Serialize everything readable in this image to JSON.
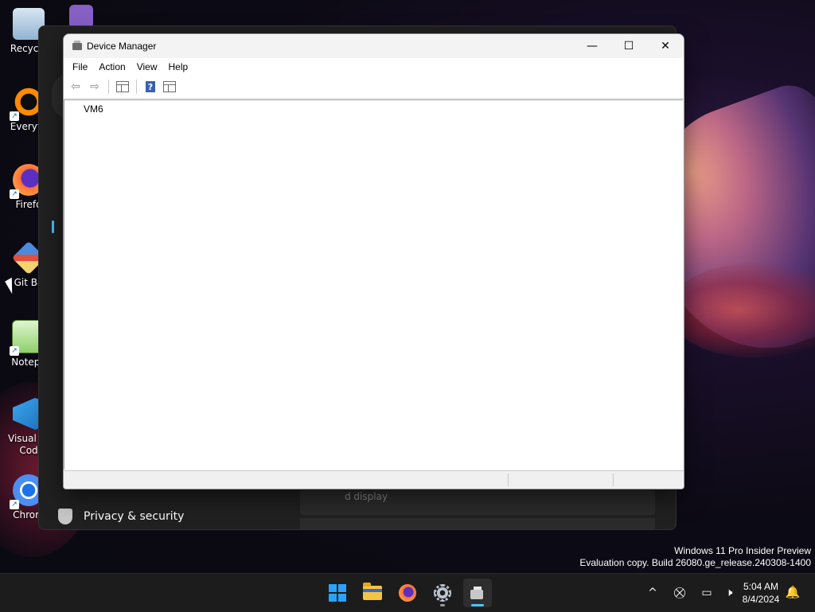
{
  "desktop": {
    "icons": [
      {
        "label": "Recycle"
      },
      {
        "label": "Everyth"
      },
      {
        "label": "Firefo"
      },
      {
        "label": "Git Ba"
      },
      {
        "label": "Notepa"
      },
      {
        "label": "Visual St\nCod"
      },
      {
        "label": "Chrom"
      }
    ]
  },
  "settings": {
    "nav_privacy": "Privacy & security",
    "content_text": "d display"
  },
  "device_manager": {
    "title": "Device Manager",
    "menu": [
      "File",
      "Action",
      "View",
      "Help"
    ],
    "tree_root": "VM6",
    "controls": {
      "minimize": "—",
      "maximize": "☐",
      "close": "✕"
    }
  },
  "watermark": {
    "line1": "Windows 11 Pro Insider Preview",
    "line2": "Evaluation copy. Build 26080.ge_release.240308-1400"
  },
  "taskbar": {
    "time": "5:04 AM",
    "date": "8/4/2024",
    "tray_chevron": "^"
  },
  "colors": {
    "accent": "#4cc2ff",
    "windows_blue": "#2aa3ff"
  }
}
